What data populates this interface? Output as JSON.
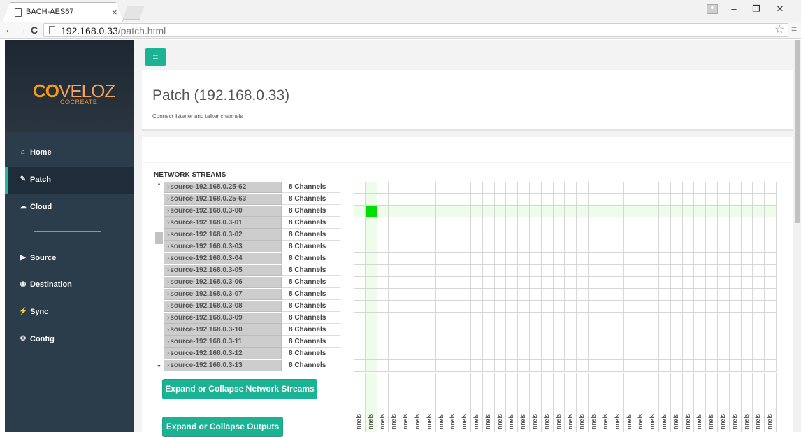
{
  "browser": {
    "tab_title": "BACH-AES67",
    "tab_close": "×",
    "url_host": "192.168.0.33",
    "url_path": "/patch.html",
    "nav_back": "←",
    "nav_forward": "→",
    "nav_reload": "C",
    "bookmark": "☆",
    "menu": "≡",
    "win_min": "–",
    "win_restore": "❐",
    "win_close": "✕"
  },
  "sidebar": {
    "logo_co": "CO",
    "logo_veloz": "VELOZ",
    "logo_sub": "COCREATE",
    "items": [
      {
        "label": "Home",
        "icon": "home-icon",
        "glyph": "⌂",
        "active": false
      },
      {
        "label": "Patch",
        "icon": "edit-icon",
        "glyph": "✎",
        "active": true
      },
      {
        "label": "Cloud",
        "icon": "cloud-icon",
        "glyph": "☁",
        "active": false
      },
      {
        "label": "Source",
        "icon": "source-icon",
        "glyph": "▶",
        "active": false
      },
      {
        "label": "Destination",
        "icon": "destination-icon",
        "glyph": "◉",
        "active": false
      },
      {
        "label": "Sync",
        "icon": "sync-icon",
        "glyph": "⚡",
        "active": false
      },
      {
        "label": "Config",
        "icon": "config-icon",
        "glyph": "⚙",
        "active": false
      }
    ]
  },
  "main": {
    "menu_toggle": "≡",
    "title": "Patch (192.168.0.33)",
    "subtitle": "Connect listener and talker channels",
    "network_streams_heading": "NETWORK STREAMS",
    "scroll_up": "▲",
    "scroll_down": "▼",
    "streams": [
      {
        "name": "source-192.168.0.25-62",
        "channels": "8 Channels"
      },
      {
        "name": "source-192.168.0.25-63",
        "channels": "8 Channels"
      },
      {
        "name": "source-192.168.0.3-00",
        "channels": "8 Channels"
      },
      {
        "name": "source-192.168.0.3-01",
        "channels": "8 Channels"
      },
      {
        "name": "source-192.168.0.3-02",
        "channels": "8 Channels"
      },
      {
        "name": "source-192.168.0.3-03",
        "channels": "8 Channels"
      },
      {
        "name": "source-192.168.0.3-04",
        "channels": "8 Channels"
      },
      {
        "name": "source-192.168.0.3-05",
        "channels": "8 Channels"
      },
      {
        "name": "source-192.168.0.3-06",
        "channels": "8 Channels"
      },
      {
        "name": "source-192.168.0.3-07",
        "channels": "8 Channels"
      },
      {
        "name": "source-192.168.0.3-08",
        "channels": "8 Channels"
      },
      {
        "name": "source-192.168.0.3-09",
        "channels": "8 Channels"
      },
      {
        "name": "source-192.168.0.3-10",
        "channels": "8 Channels"
      },
      {
        "name": "source-192.168.0.3-11",
        "channels": "8 Channels"
      },
      {
        "name": "source-192.168.0.3-12",
        "channels": "8 Channels"
      },
      {
        "name": "source-192.168.0.3-13",
        "channels": "8 Channels"
      }
    ],
    "grid": {
      "columns": 36,
      "highlight_column": 1,
      "highlight_row": 2,
      "connected": [
        {
          "row": 2,
          "col": 1
        }
      ]
    },
    "output_column_label": "nnels",
    "buttons": {
      "expand_streams": "Expand or Collapse Network Streams",
      "expand_outputs": "Expand or Collapse Outputs"
    }
  },
  "colors": {
    "accent": "#1bb394",
    "sidebar_bg": "#2b3c4b",
    "connected": "#00e000",
    "highlight": "#edfdea",
    "logo_orange": "#f39c12"
  }
}
